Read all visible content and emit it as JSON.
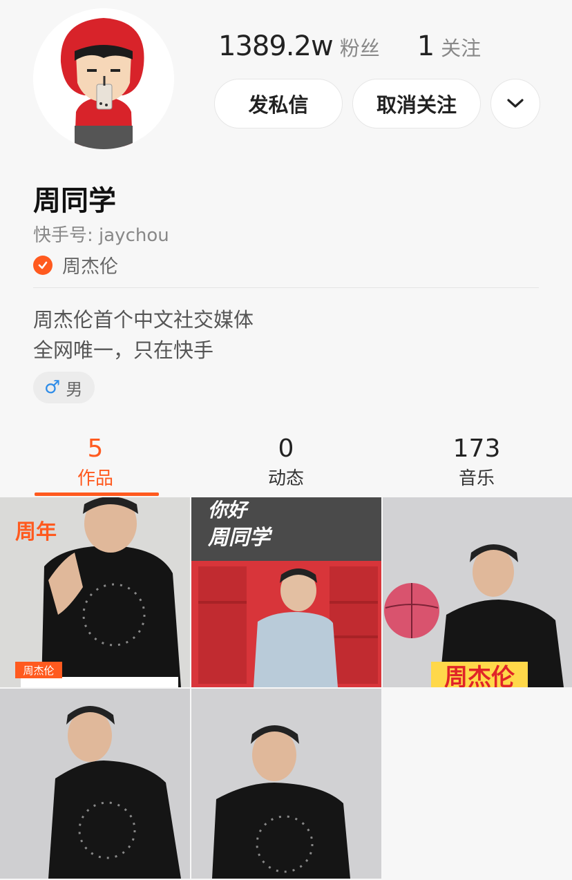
{
  "profile": {
    "followers_count": "1389.2w",
    "followers_label": "粉丝",
    "following_count": "1",
    "following_label": "关注",
    "name": "周同学",
    "kuaishou_id": "快手号: jaychou",
    "verified_name": "周杰伦",
    "bio_line1": "周杰伦首个中文社交媒体",
    "bio_line2": "全网唯一，只在快手",
    "gender_icon": "♂",
    "gender": "男"
  },
  "actions": {
    "message_label": "发私信",
    "unfollow_label": "取消关注",
    "more_icon": "chevron-down-icon"
  },
  "tabs": [
    {
      "count": "5",
      "label": "作品",
      "active": true
    },
    {
      "count": "0",
      "label": "动态",
      "active": false
    },
    {
      "count": "173",
      "label": "音乐",
      "active": false
    }
  ],
  "videos": [
    {
      "overlay_text": "周年",
      "tag": "周杰伦"
    },
    {
      "overlay_text": "你好",
      "overlay_text2": "周同学"
    },
    {
      "overlay_text": "周杰伦"
    },
    {
      "overlay_text": ""
    },
    {
      "overlay_text": ""
    }
  ],
  "colors": {
    "accent": "#ff5a1f",
    "male": "#2e8ce8"
  }
}
